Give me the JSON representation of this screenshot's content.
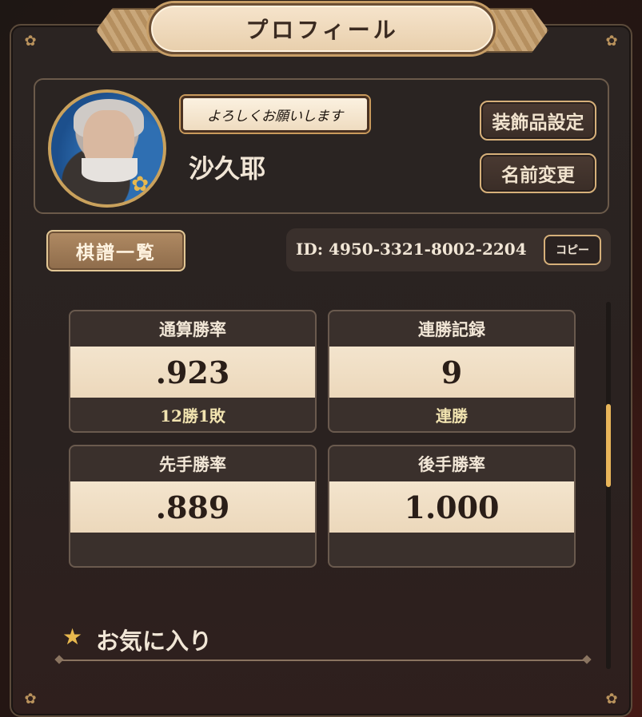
{
  "header": {
    "title": "プロフィール"
  },
  "profile": {
    "greeting": "よろしくお願いします",
    "name": "沙久耶",
    "buttons": {
      "decor": "装飾品設定",
      "rename": "名前変更"
    }
  },
  "kifu_button": "棋譜一覧",
  "id_section": {
    "id_text": "ID: 4950-3321-8002-2204",
    "copy_label": "コピー"
  },
  "stats": [
    {
      "label": "通算勝率",
      "value": ".923",
      "sub": "12勝1敗"
    },
    {
      "label": "連勝記録",
      "value": "9",
      "sub": "連勝"
    },
    {
      "label": "先手勝率",
      "value": ".889",
      "sub": ""
    },
    {
      "label": "後手勝率",
      "value": "1.000",
      "sub": ""
    }
  ],
  "favorites": {
    "title": "お気に入り"
  },
  "colors": {
    "accent_gold": "#e8b84e",
    "panel_bg": "#2a2422",
    "value_bg": "#f3e4cd"
  }
}
